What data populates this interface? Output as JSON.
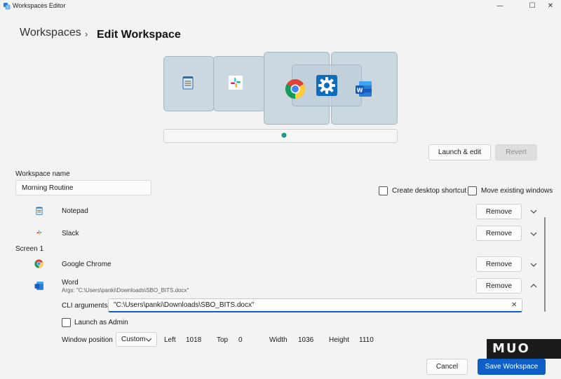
{
  "window": {
    "title": "Workspaces Editor",
    "min_glyph": "—",
    "max_glyph": "☐",
    "close_glyph": "✕"
  },
  "breadcrumb": {
    "root": "Workspaces",
    "separator": "›",
    "current": "Edit Workspace"
  },
  "toolbar": {
    "launch_edit": "Launch & edit",
    "revert": "Revert"
  },
  "workspace": {
    "name_label": "Workspace name",
    "name_value": "Morning Routine",
    "create_shortcut": "Create desktop shortcut",
    "move_windows": "Move existing windows"
  },
  "apps": [
    {
      "name": "Notepad",
      "remove": "Remove",
      "icon": "notepad-icon"
    },
    {
      "name": "Slack",
      "remove": "Remove",
      "icon": "slack-icon"
    },
    {
      "name": "Google Chrome",
      "remove": "Remove",
      "icon": "chrome-icon"
    },
    {
      "name": "Word",
      "args": "Args: \"C:\\Users\\panki\\Downloads\\SBO_BITS.docx\"",
      "remove": "Remove",
      "icon": "word-icon"
    }
  ],
  "screen_label": "Screen 1",
  "word_details": {
    "cli_label": "CLI arguments",
    "cli_value": "\"C:\\Users\\panki\\Downloads\\SBO_BITS.docx\"",
    "clear_glyph": "✕",
    "launch_admin": "Launch as Admin",
    "window_position_label": "Window position",
    "position_mode": "Custom",
    "left_label": "Left",
    "left_value": "1018",
    "top_label": "Top",
    "top_value": "0",
    "width_label": "Width",
    "width_value": "1036",
    "height_label": "Height",
    "height_value": "1110"
  },
  "footer": {
    "cancel": "Cancel",
    "save": "Save Workspace"
  },
  "watermark": "MUO",
  "colors": {
    "accent": "#0f5fc9",
    "tile": "#ccd8e0",
    "background": "#f3f3f3"
  }
}
